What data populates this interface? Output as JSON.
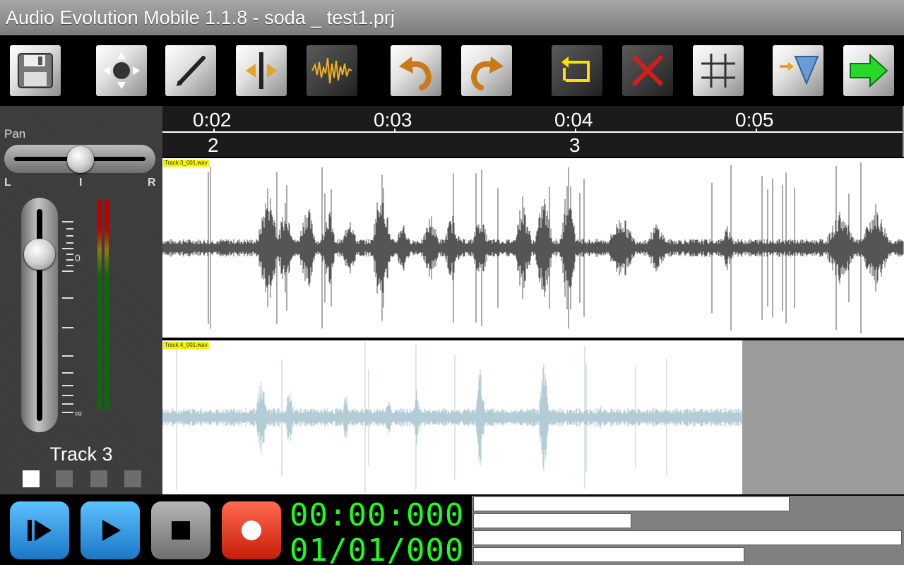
{
  "app": {
    "title": "Audio Evolution Mobile 1.1.8 - soda _ test1.prj"
  },
  "toolbar": {
    "buttons": [
      {
        "name": "save-icon"
      },
      {
        "name": "move-icon"
      },
      {
        "name": "pencil-icon"
      },
      {
        "name": "split-icon"
      },
      {
        "name": "waveform-icon"
      },
      {
        "name": "undo-icon"
      },
      {
        "name": "redo-icon"
      },
      {
        "name": "loop-icon"
      },
      {
        "name": "delete-icon"
      },
      {
        "name": "grid-icon"
      },
      {
        "name": "import-icon"
      },
      {
        "name": "forward-icon"
      }
    ]
  },
  "mixer": {
    "pan_label": "Pan",
    "pan_left": "L",
    "pan_center": "I",
    "pan_right": "R",
    "scale_zero": "0",
    "scale_inf": "∞",
    "track_name": "Track 3",
    "track_count": 4,
    "selected_track_index": 0
  },
  "timeline": {
    "time_labels": [
      "0:02",
      "0:03",
      "0:04",
      "0:05"
    ],
    "bar_labels": [
      "2",
      "3"
    ]
  },
  "tracks": [
    {
      "clip_name": "Track 3_001.wav",
      "color": "#555555"
    },
    {
      "clip_name": "Track 4_001.wav",
      "color": "#b4ccd6"
    }
  ],
  "transport": {
    "time": "00:00:000",
    "position": "01/01/000"
  },
  "colors": {
    "time_display": "#1bff1b",
    "clip_label_bg": "#f5f500"
  }
}
